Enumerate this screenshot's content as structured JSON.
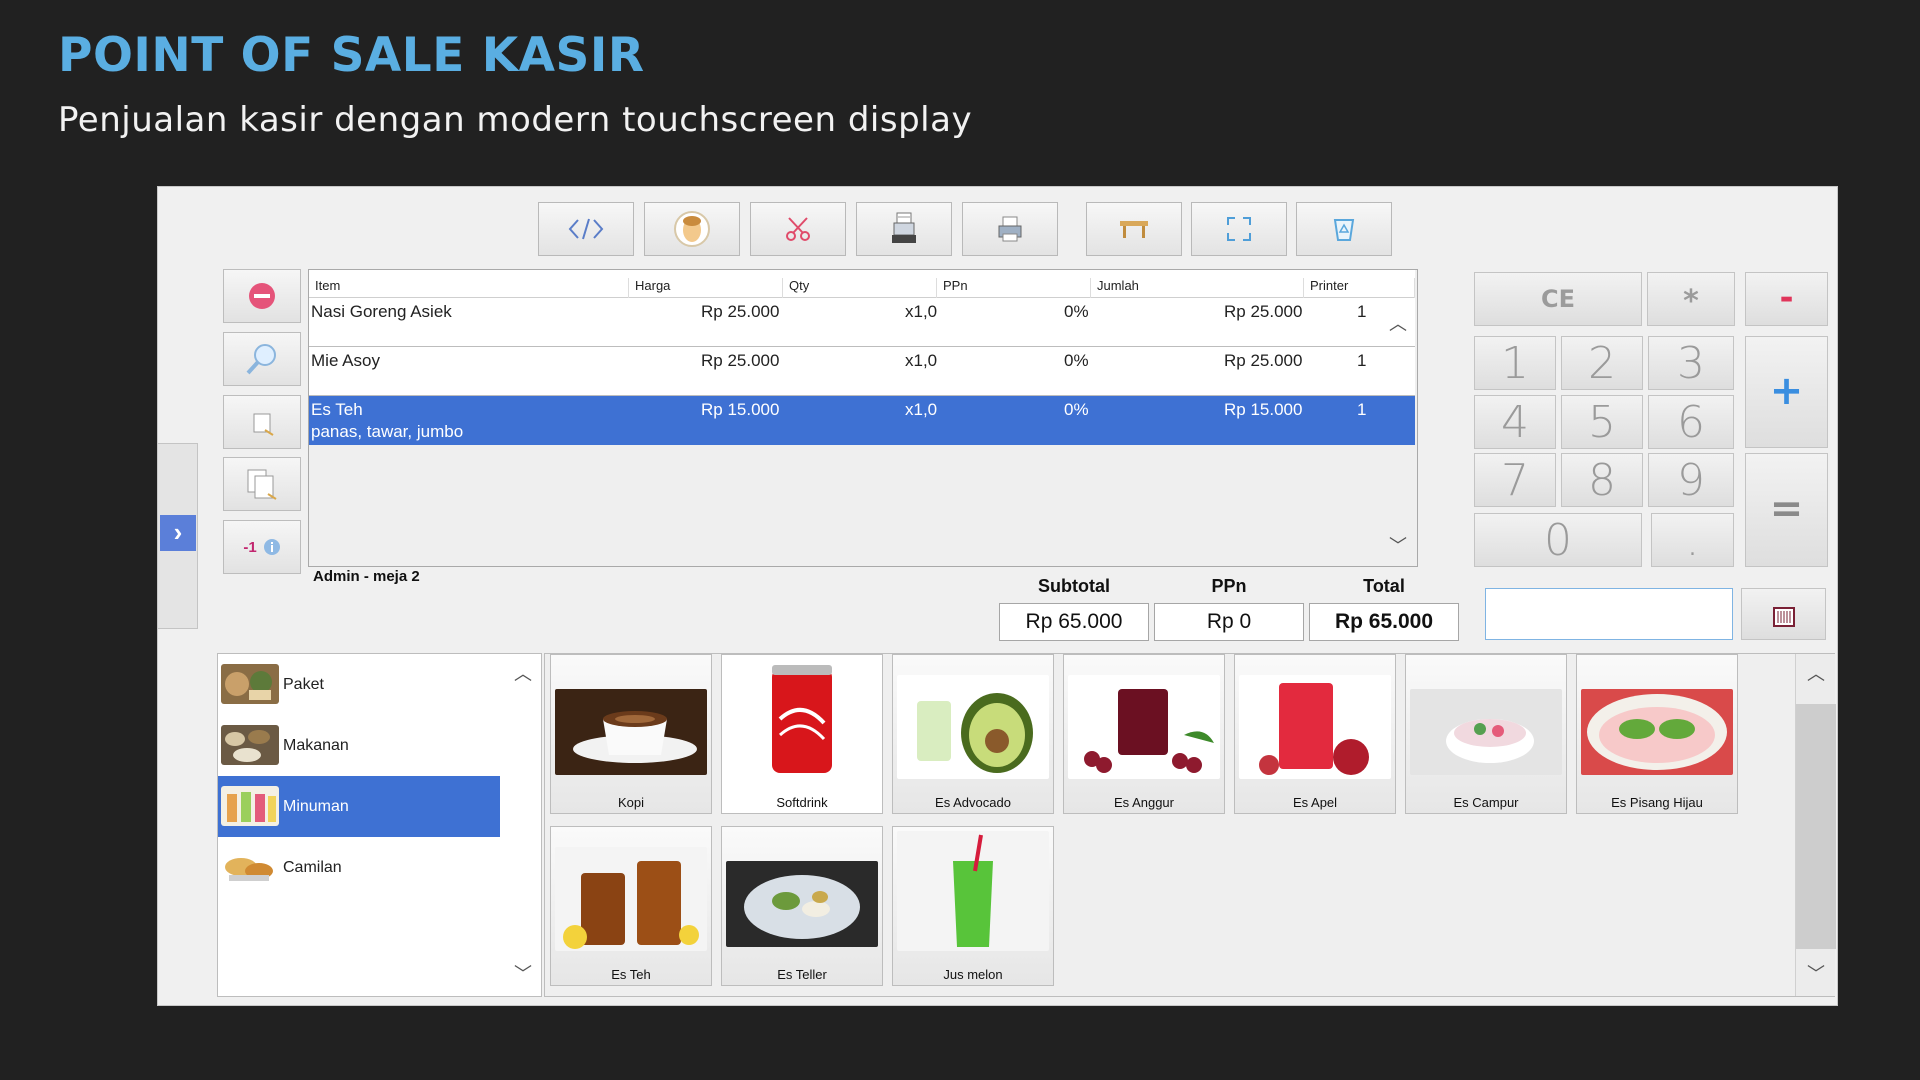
{
  "slide": {
    "title": "POINT OF SALE KASIR",
    "subtitle": "Penjualan kasir dengan modern touchscreen display"
  },
  "toolbar": {
    "buttons": [
      {
        "icon": "code-icon"
      },
      {
        "icon": "face-icon"
      },
      {
        "icon": "scissors-icon"
      },
      {
        "icon": "cash-register-icon"
      },
      {
        "icon": "printer-icon"
      },
      {
        "icon": "table-icon"
      },
      {
        "icon": "fullscreen-icon"
      },
      {
        "icon": "recycle-bin-icon"
      }
    ]
  },
  "actions": {
    "decrement_label": "-1"
  },
  "grid": {
    "columns": [
      "Item",
      "Harga",
      "Qty",
      "PPn",
      "Jumlah",
      "Printer"
    ],
    "rows": [
      {
        "item": "Nasi Goreng Asiek",
        "note": "",
        "harga": "Rp 25.000",
        "qty": "x1,0",
        "ppn": "0%",
        "jumlah": "Rp 25.000",
        "printer": "1"
      },
      {
        "item": "Mie Asoy",
        "note": "",
        "harga": "Rp 25.000",
        "qty": "x1,0",
        "ppn": "0%",
        "jumlah": "Rp 25.000",
        "printer": "1"
      },
      {
        "item": "Es Teh",
        "note": "panas, tawar, jumbo",
        "harga": "Rp 15.000",
        "qty": "x1,0",
        "ppn": "0%",
        "jumlah": "Rp 15.000",
        "printer": "1"
      }
    ],
    "selected_row": 2
  },
  "footer": {
    "user_table": "Admin - meja 2",
    "subtotal_label": "Subtotal",
    "ppn_label": "PPn",
    "total_label": "Total",
    "subtotal": "Rp 65.000",
    "ppn": "Rp 0",
    "total": "Rp 65.000"
  },
  "keypad": {
    "ce": "CE",
    "star": "*",
    "minus": "-",
    "plus": "+",
    "equals": "=",
    "dot": ".",
    "digits": [
      "1",
      "2",
      "3",
      "4",
      "5",
      "6",
      "7",
      "8",
      "9",
      "0"
    ],
    "input_value": ""
  },
  "categories": {
    "items": [
      "Paket",
      "Makanan",
      "Minuman",
      "Camilan"
    ],
    "selected": 2
  },
  "products": {
    "items": [
      "Kopi",
      "Softdrink",
      "Es Advocado",
      "Es Anggur",
      "Es Apel",
      "Es Campur",
      "Es Pisang Hijau",
      "Es Teh",
      "Es Teller",
      "Jus melon"
    ]
  },
  "colors": {
    "title_accent": "#5aaee2",
    "selection_blue": "#3e71d3",
    "keypad_blue": "#3a8ee0",
    "keypad_red": "#e0345a"
  }
}
